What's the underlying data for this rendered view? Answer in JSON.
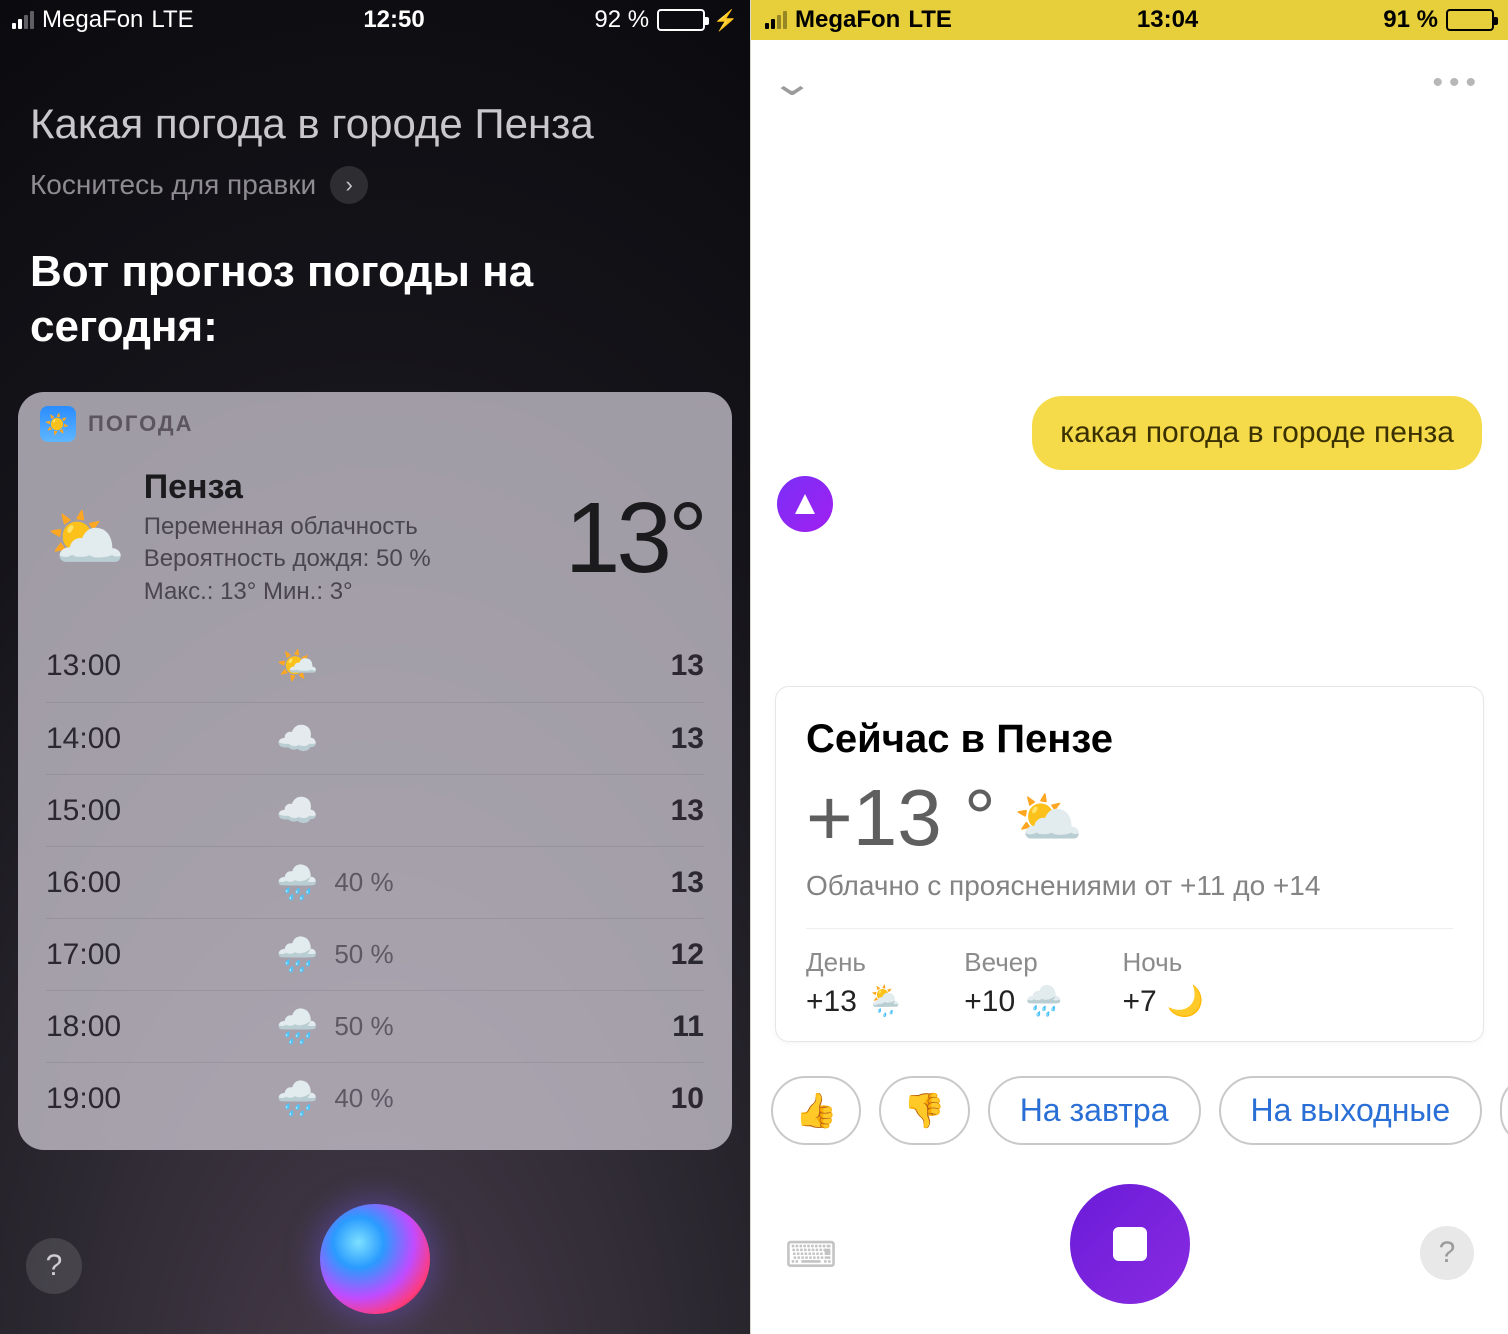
{
  "left": {
    "status": {
      "carrier": "MegaFon",
      "nettype": "LTE",
      "time": "12:50",
      "battery_pct": "92 %",
      "battery_fill_pct": 92,
      "battery_color": "#35d15a",
      "charging": true
    },
    "query": "Какая погода в городе Пенза",
    "edit_hint": "Коснитесь для правки",
    "answer": "Вот прогноз погоды на сегодня:",
    "card": {
      "app_label": "ПОГОДА",
      "city": "Пенза",
      "cond": "Переменная облачность",
      "rain_line": "Вероятность дождя: 50 %",
      "range_line": "Макс.: 13° Мин.: 3°",
      "now_temp": "13°",
      "now_icon": "⛅",
      "hours": [
        {
          "time": "13:00",
          "icon": "🌤️",
          "pct": "",
          "t": "13"
        },
        {
          "time": "14:00",
          "icon": "☁️",
          "pct": "",
          "t": "13"
        },
        {
          "time": "15:00",
          "icon": "☁️",
          "pct": "",
          "t": "13"
        },
        {
          "time": "16:00",
          "icon": "🌧️",
          "pct": "40 %",
          "t": "13"
        },
        {
          "time": "17:00",
          "icon": "🌧️",
          "pct": "50 %",
          "t": "12"
        },
        {
          "time": "18:00",
          "icon": "🌧️",
          "pct": "50 %",
          "t": "11"
        },
        {
          "time": "19:00",
          "icon": "🌧️",
          "pct": "40 %",
          "t": "10"
        }
      ]
    },
    "help_label": "?"
  },
  "right": {
    "status": {
      "carrier": "MegaFon",
      "nettype": "LTE",
      "time": "13:04",
      "battery_pct": "91 %",
      "battery_fill_pct": 91,
      "battery_color": "#000000"
    },
    "user_msg": "какая погода в городе пенза",
    "card": {
      "title": "Сейчас в Пензе",
      "now_temp": "+13 °",
      "now_icon": "⛅",
      "cond": "Облачно с прояснениями от +11 до +14",
      "parts": [
        {
          "label": "День",
          "temp": "+13",
          "icon": "🌦️"
        },
        {
          "label": "Вечер",
          "temp": "+10",
          "icon": "🌧️"
        },
        {
          "label": "Ночь",
          "temp": "+7",
          "icon": "🌙"
        }
      ]
    },
    "chips": {
      "thumbs_up": "👍",
      "thumbs_down": "👎",
      "tomorrow": "На завтра",
      "weekend": "На выходные"
    },
    "help_label": "?"
  }
}
